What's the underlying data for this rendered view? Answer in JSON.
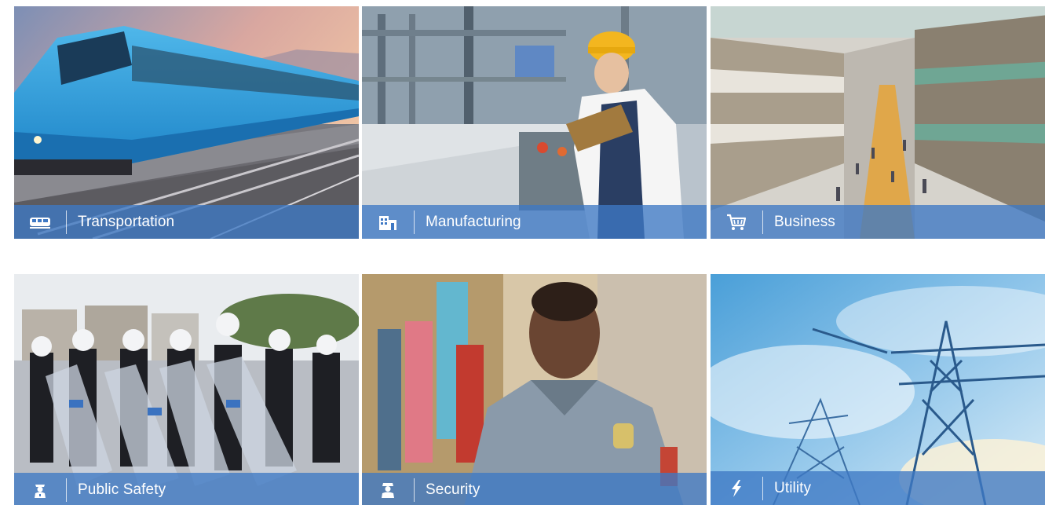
{
  "tiles": [
    {
      "label": "Transportation",
      "icon": "train-icon"
    },
    {
      "label": "Manufacturing",
      "icon": "factory-building-icon"
    },
    {
      "label": "Business",
      "icon": "shopping-cart-icon"
    },
    {
      "label": "Public Safety",
      "icon": "police-officer-icon"
    },
    {
      "label": "Security",
      "icon": "security-guard-icon"
    },
    {
      "label": "Utility",
      "icon": "lightning-bolt-icon"
    }
  ],
  "colors": {
    "caption_bar": "#3E78C4",
    "caption_text": "#FFFFFF"
  }
}
